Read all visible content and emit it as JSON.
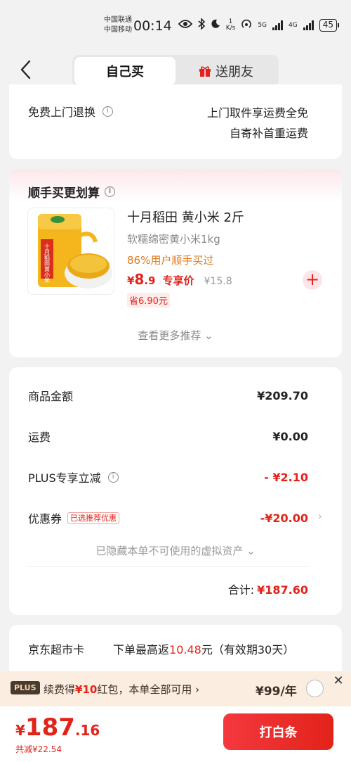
{
  "status_bar": {
    "carrier_1": "中国联通",
    "carrier_2": "中国移动",
    "time": "00:14",
    "speed_value": "1",
    "speed_unit": "K/s",
    "net_1": "5G",
    "net_2": "4G",
    "battery": "45"
  },
  "header": {
    "tabs": [
      {
        "label": "自己买",
        "active": true
      },
      {
        "label": "送朋友",
        "active": false
      }
    ]
  },
  "return_service": {
    "label": "免费上门退换",
    "line_1": "上门取件享运费全免",
    "line_2": "自寄补首重运费"
  },
  "addon": {
    "title": "顺手买更划算",
    "product": {
      "name": "十月稻田 黄小米 2斤",
      "subtitle": "软糯绵密黄小米1kg",
      "tag": "86%用户顺手买过",
      "price_currency": "¥",
      "price_int": "8",
      "price_dec": ".9",
      "price_label": "专享价",
      "orig_price": "¥15.8",
      "save": "省6.90元",
      "package_text": "十月稻田黄小米"
    },
    "more": "查看更多推荐"
  },
  "summary": {
    "rows": [
      {
        "label": "商品金额",
        "value": "¥209.70"
      },
      {
        "label": "运费",
        "value": "¥0.00"
      },
      {
        "label": "PLUS专享立减",
        "value": "- ¥2.10"
      },
      {
        "label": "优惠券",
        "badge": "已选推荐优惠",
        "value": "-¥20.00"
      }
    ],
    "hidden_assets": "已隐藏本单不可使用的虚拟资产",
    "total_label": "合计:",
    "total_value": "¥187.60"
  },
  "supermarket_card": {
    "label": "京东超市卡",
    "text_pre": "下单最高返",
    "amount": "10.48",
    "text_post": "元（有效期30天）"
  },
  "plus_banner": {
    "logo": "PLUS",
    "text_pre": "续费得",
    "red_amount": "¥10",
    "text_post": "红包，本单全部可用",
    "price": "¥99/年"
  },
  "bottom": {
    "currency": "¥",
    "price_int": "187",
    "price_dec": ".16",
    "discount_note": "共减¥22.54",
    "pay_button": "打白条"
  },
  "colors": {
    "accent_red": "#e2231a",
    "orange_tag": "#e07a1f",
    "plus_banner_bg": "#fbeee0"
  }
}
